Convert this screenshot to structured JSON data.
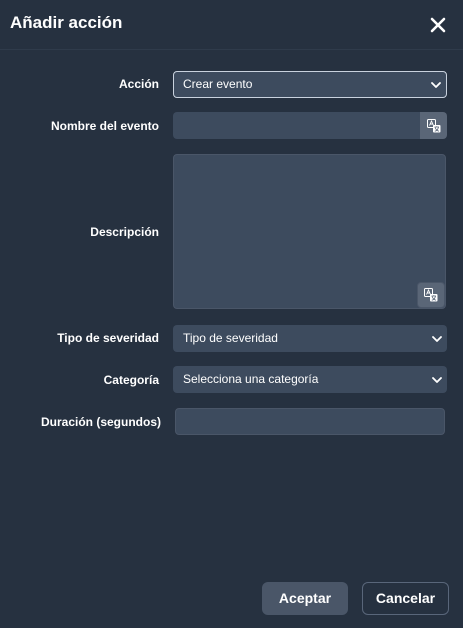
{
  "dialog": {
    "title": "Añadir acción",
    "close_icon": "close-icon"
  },
  "form": {
    "action": {
      "label": "Acción",
      "value": "Crear evento"
    },
    "event_name": {
      "label": "Nombre del evento",
      "value": "",
      "translate_icon": "translate-icon"
    },
    "description": {
      "label": "Descripción",
      "value": "",
      "translate_icon": "translate-icon"
    },
    "severity": {
      "label": "Tipo de severidad",
      "value": "Tipo de severidad"
    },
    "category": {
      "label": "Categoría",
      "value": "Selecciona una categoría"
    },
    "duration": {
      "label": "Duración (segundos)",
      "value": ""
    }
  },
  "footer": {
    "accept_label": "Aceptar",
    "cancel_label": "Cancelar"
  },
  "colors": {
    "background": "#263140",
    "field": "#3d4b5e",
    "primary_button": "#4a5668"
  }
}
